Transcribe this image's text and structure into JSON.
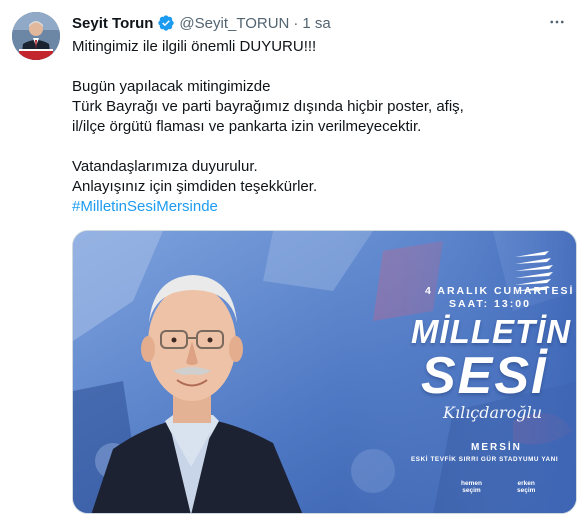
{
  "tweet": {
    "display_name": "Seyit Torun",
    "handle": "@Seyit_TORUN",
    "separator": "·",
    "time": "1 sa",
    "verified": true,
    "lines": [
      "Mitingimiz ile ilgili önemli DUYURU!!!",
      "Bugün yapılacak mitingimizde",
      "Türk Bayrağı ve parti bayrağımız dışında hiçbir poster, afiş,",
      "il/ilçe örgütü flaması ve pankarta izin verilmeyecektir.",
      "Vatandaşlarımıza duyurulur.",
      "Anlayışınız için şimdiden teşekkürler."
    ],
    "hashtag": "#MilletinSesiMersinde"
  },
  "poster": {
    "date_line": "4 ARALIK CUMARTESİ",
    "time_line": "SAAT: 13:00",
    "title_1": "MİLLETİN",
    "title_2": "SESİ",
    "signature": "Kılıçdaroğlu",
    "city": "MERSİN",
    "venue": "ESKİ TEVFİK SIRRI GÜR STADYUMU YANI",
    "logo_1": [
      "hemen",
      "seçim"
    ],
    "logo_2": [
      "erken",
      "seçim"
    ]
  },
  "colors": {
    "text": "#0f1419",
    "secondary": "#536471",
    "link": "#1d9bf0",
    "verified": "#1d9bf0",
    "poster_bg": "#5f86c9"
  },
  "icons": {
    "verified": "verified-badge-icon",
    "more": "more-options-icon",
    "party_logo": "six-arrows-logo-icon"
  }
}
